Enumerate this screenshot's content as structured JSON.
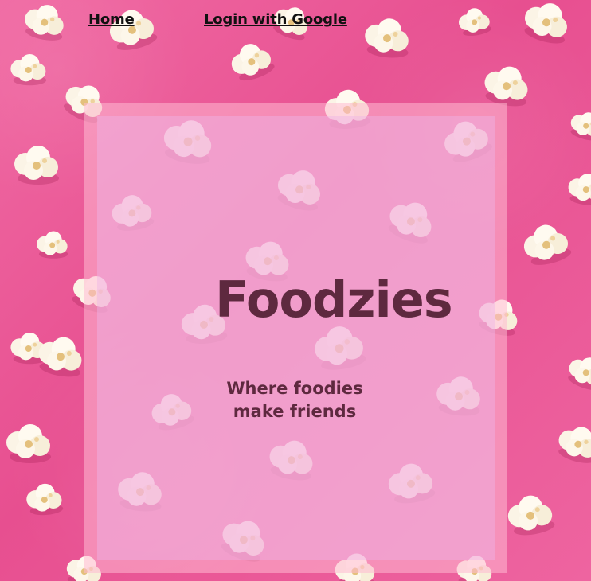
{
  "nav": {
    "home_label": "Home",
    "login_label": "Login with Google"
  },
  "hero": {
    "title": "Foodzies",
    "tagline_line1": "Where foodies",
    "tagline_line2": "make friends"
  },
  "colors": {
    "background": "#ec5b98",
    "title_text": "#4a1a2c",
    "nav_text": "#111111"
  },
  "background_image": "popcorn-on-pink"
}
